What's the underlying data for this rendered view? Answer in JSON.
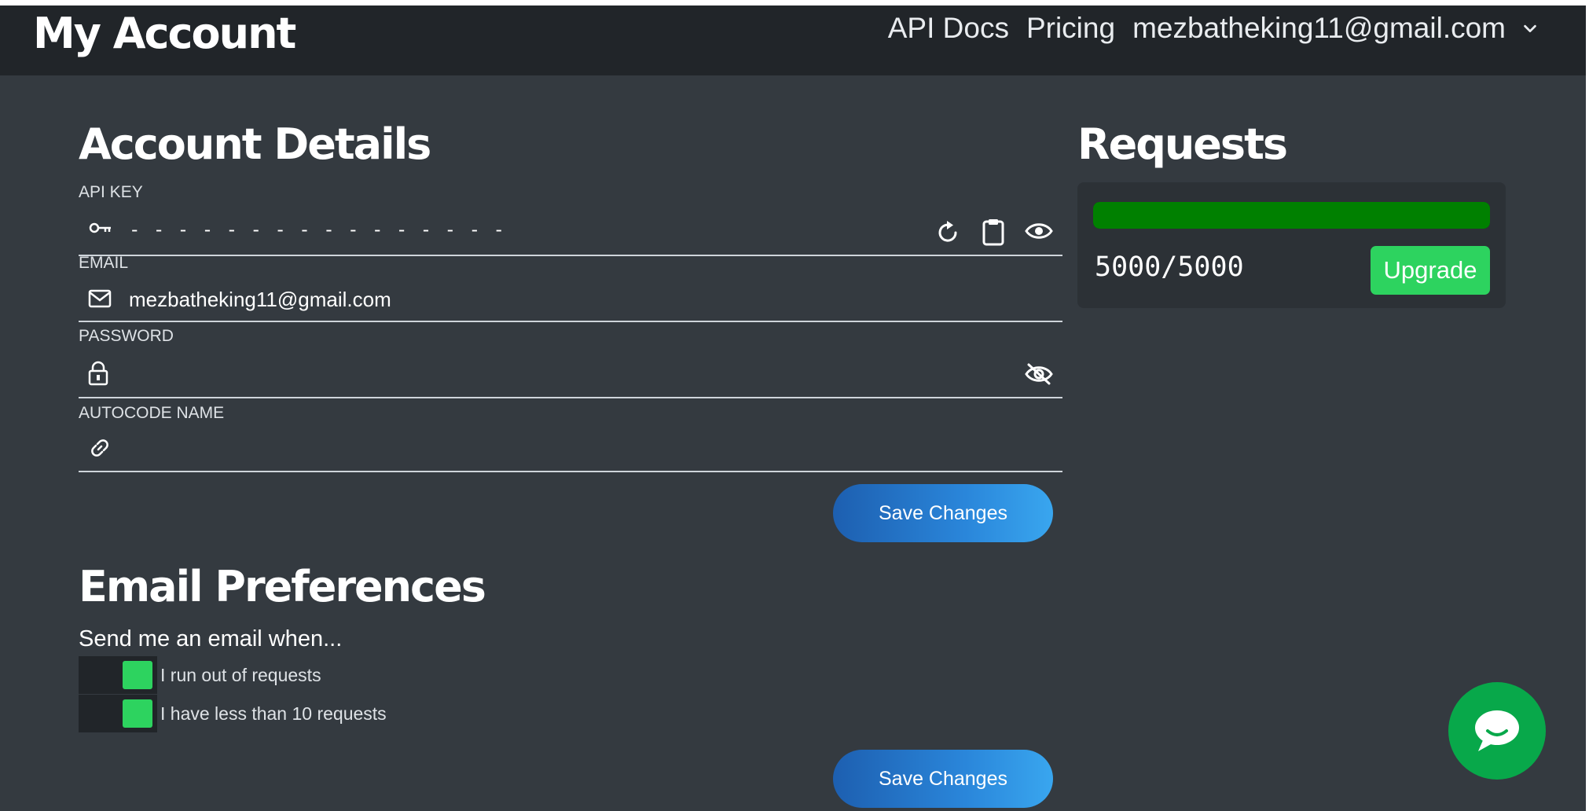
{
  "header": {
    "title": "My Account",
    "nav": [
      "API Docs",
      "Pricing",
      "mezbatheking11@gmail.com"
    ]
  },
  "account": {
    "title": "Account Details",
    "fields": [
      {
        "label": "API KEY",
        "value": "- - - - - - - - - - - - - - - -",
        "icon": "key-icon"
      },
      {
        "label": "EMAIL",
        "value": "mezbatheking11@gmail.com",
        "icon": "mail-icon"
      },
      {
        "label": "PASSWORD",
        "value": "",
        "icon": "lock-icon"
      },
      {
        "label": "AUTOCODE NAME",
        "value": "",
        "icon": "link-icon"
      }
    ],
    "save_label": "Save Changes"
  },
  "requests": {
    "title": "Requests",
    "count_text": "5000/5000",
    "progress_fraction": 1.0,
    "upgrade_label": "Upgrade"
  },
  "email_prefs": {
    "title": "Email Preferences",
    "intro": "Send me an email when...",
    "options": [
      {
        "label": "I run out of requests",
        "checked": true
      },
      {
        "label": "I have less than 10 requests",
        "checked": true
      }
    ],
    "save_label": "Save Changes"
  },
  "colors": {
    "background": "#343a40",
    "navbar": "#212529",
    "accent_green": "#2dd35f",
    "progress_green": "#008000",
    "button_blue": "#2a86da",
    "chat_green": "#08a84a"
  }
}
